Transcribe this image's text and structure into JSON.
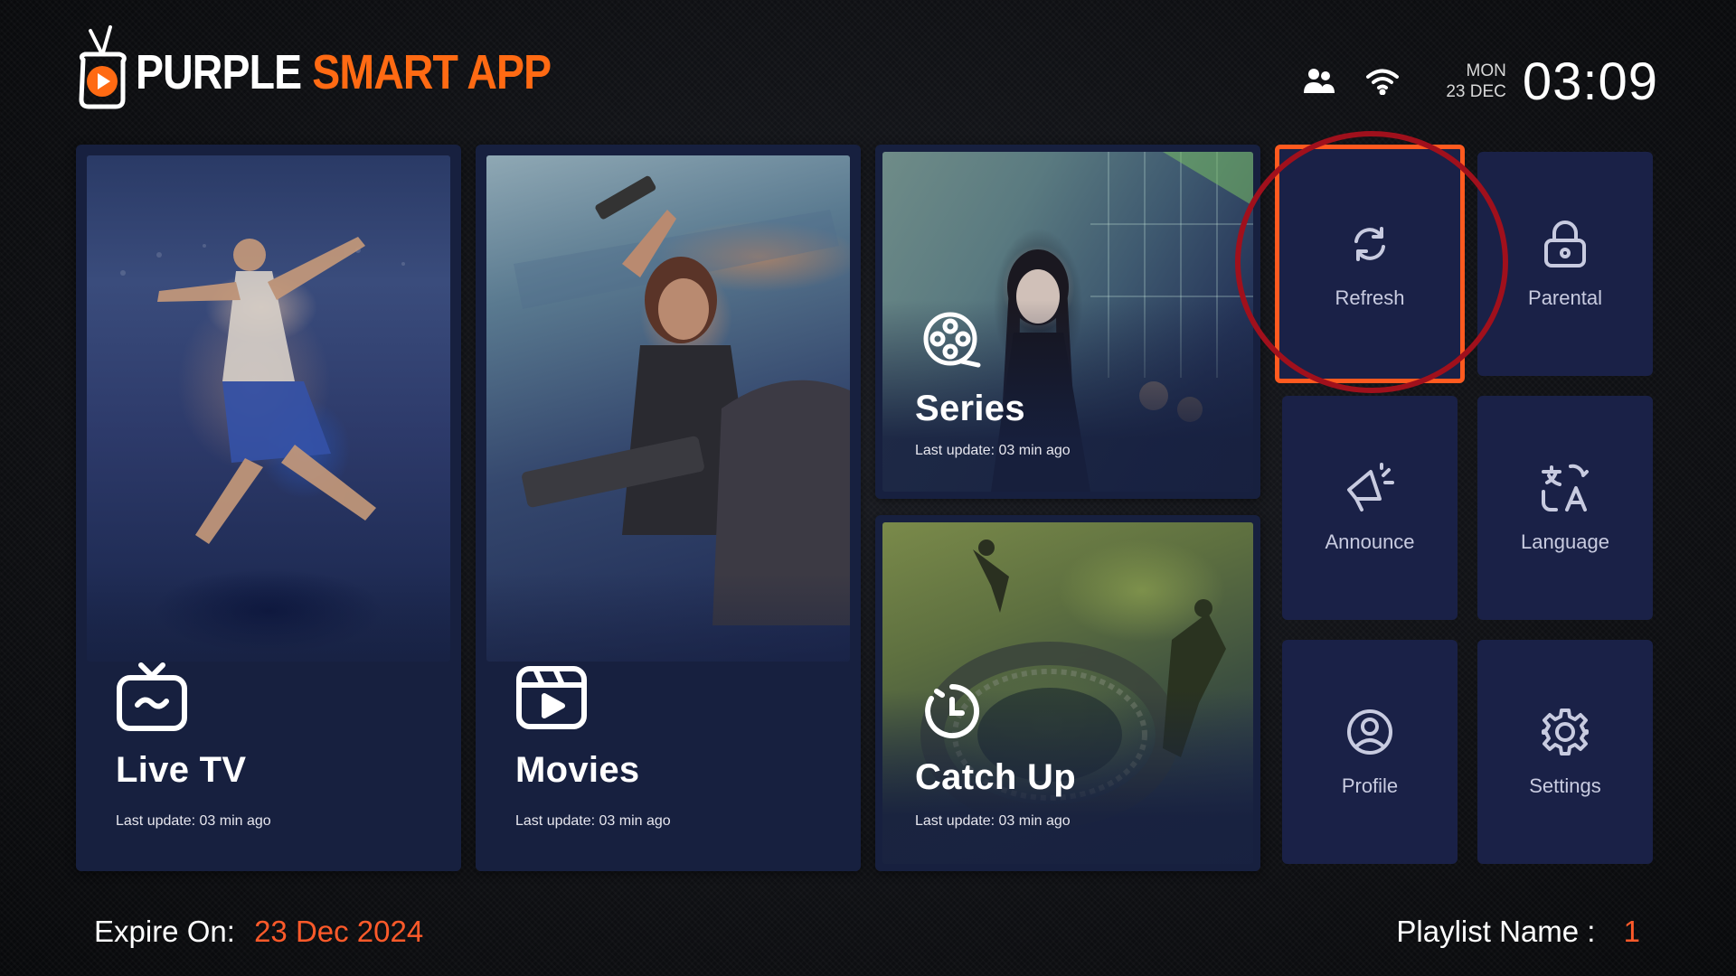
{
  "header": {
    "logo_word1": "PURPLE",
    "logo_word2": "SMART APP",
    "day": "MON",
    "date": "23 DEC",
    "time": "03:09"
  },
  "tiles": [
    {
      "id": "live-tv",
      "title": "Live TV",
      "subtitle": "Last update: 03 min ago",
      "icon": "tv-icon"
    },
    {
      "id": "movies",
      "title": "Movies",
      "subtitle": "Last update: 03 min ago",
      "icon": "film-play-icon"
    },
    {
      "id": "series",
      "title": "Series",
      "subtitle": "Last update: 03 min ago",
      "icon": "film-reel-icon"
    },
    {
      "id": "catch-up",
      "title": "Catch Up",
      "subtitle": "Last update: 03 min ago",
      "icon": "clock-icon"
    }
  ],
  "menu": [
    {
      "label": "Refresh",
      "icon": "refresh-icon",
      "focused": true
    },
    {
      "label": "Parental",
      "icon": "lock-icon"
    },
    {
      "label": "Announce",
      "icon": "megaphone-icon"
    },
    {
      "label": "Language",
      "icon": "translate-icon"
    },
    {
      "label": "Profile",
      "icon": "user-icon"
    },
    {
      "label": "Settings",
      "icon": "gear-icon"
    }
  ],
  "footer": {
    "expire_label": "Expire On:",
    "expire_value": "23 Dec 2024",
    "playlist_label": "Playlist Name :",
    "playlist_value": "1"
  },
  "colors": {
    "accent": "#ff6a13",
    "tile_bg": "#17203f",
    "menu_bg": "#1a2147",
    "focus_border": "#ff5a1f",
    "annotation_ring": "#a0101c"
  }
}
